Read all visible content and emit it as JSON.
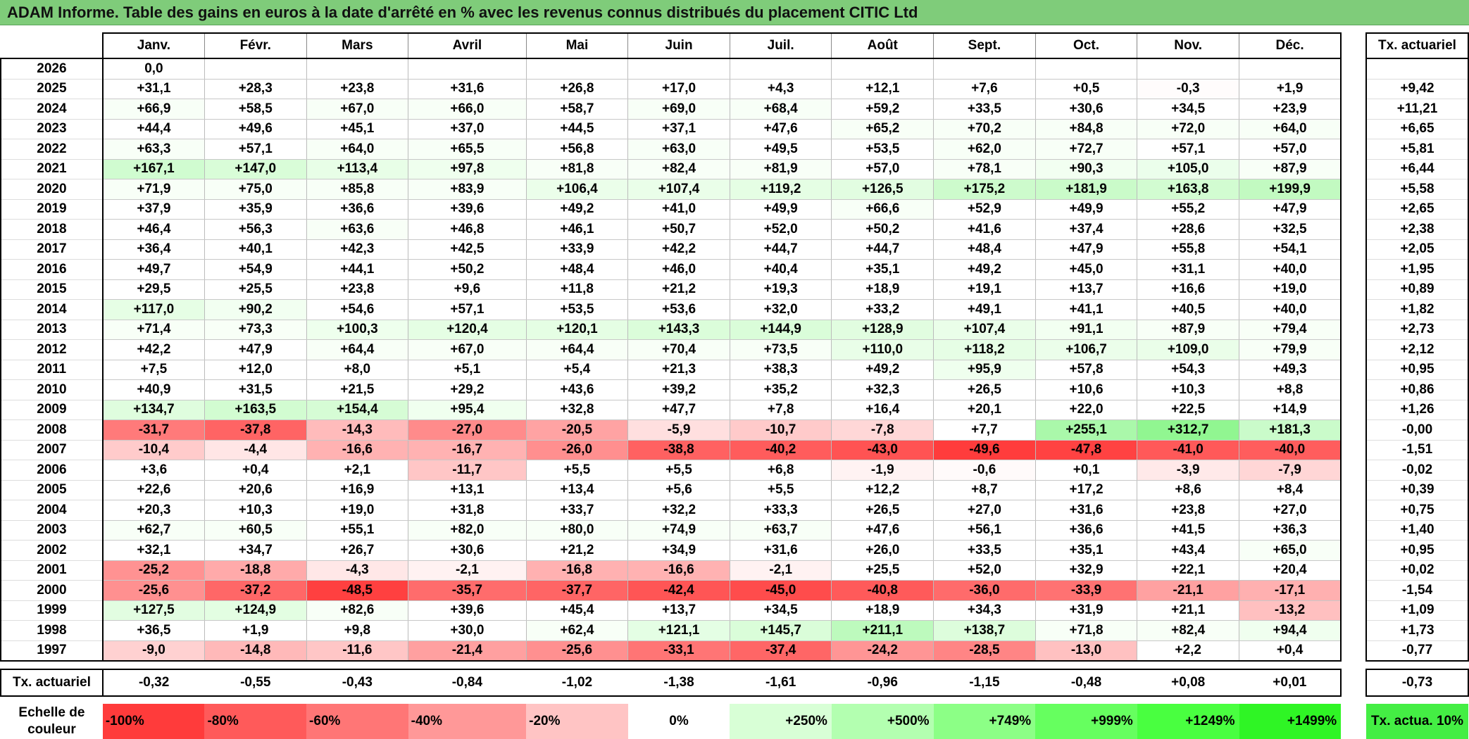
{
  "title": "ADAM Informe. Table des gains en euros à la date d'arrêté en % avec les revenus connus distribués du placement CITIC Ltd",
  "months": [
    "Janv.",
    "Févr.",
    "Mars",
    "Avril",
    "Mai",
    "Juin",
    "Juil.",
    "Août",
    "Sept.",
    "Oct.",
    "Nov.",
    "Déc."
  ],
  "rate_header": "Tx. actuariel",
  "rows": [
    {
      "year": "2026",
      "values": [
        "0,0",
        "",
        "",
        "",
        "",
        "",
        "",
        "",
        "",
        "",
        "",
        ""
      ],
      "rate": ""
    },
    {
      "year": "2025",
      "values": [
        "+31,1",
        "+28,3",
        "+23,8",
        "+31,6",
        "+26,8",
        "+17,0",
        "+4,3",
        "+12,1",
        "+7,6",
        "+0,5",
        "-0,3",
        "+1,9"
      ],
      "rate": "+9,42"
    },
    {
      "year": "2024",
      "values": [
        "+66,9",
        "+58,5",
        "+67,0",
        "+66,0",
        "+58,7",
        "+69,0",
        "+68,4",
        "+59,2",
        "+33,5",
        "+30,6",
        "+34,5",
        "+23,9"
      ],
      "rate": "+11,21"
    },
    {
      "year": "2023",
      "values": [
        "+44,4",
        "+49,6",
        "+45,1",
        "+37,0",
        "+44,5",
        "+37,1",
        "+47,6",
        "+65,2",
        "+70,2",
        "+84,8",
        "+72,0",
        "+64,0"
      ],
      "rate": "+6,65"
    },
    {
      "year": "2022",
      "values": [
        "+63,3",
        "+57,1",
        "+64,0",
        "+65,5",
        "+56,8",
        "+63,0",
        "+49,5",
        "+53,5",
        "+62,0",
        "+72,7",
        "+57,1",
        "+57,0"
      ],
      "rate": "+5,81"
    },
    {
      "year": "2021",
      "values": [
        "+167,1",
        "+147,0",
        "+113,4",
        "+97,8",
        "+81,8",
        "+82,4",
        "+81,9",
        "+57,0",
        "+78,1",
        "+90,3",
        "+105,0",
        "+87,9"
      ],
      "rate": "+6,44"
    },
    {
      "year": "2020",
      "values": [
        "+71,9",
        "+75,0",
        "+85,8",
        "+83,9",
        "+106,4",
        "+107,4",
        "+119,2",
        "+126,5",
        "+175,2",
        "+181,9",
        "+163,8",
        "+199,9"
      ],
      "rate": "+5,58"
    },
    {
      "year": "2019",
      "values": [
        "+37,9",
        "+35,9",
        "+36,6",
        "+39,6",
        "+49,2",
        "+41,0",
        "+49,9",
        "+66,6",
        "+52,9",
        "+49,9",
        "+55,2",
        "+47,9"
      ],
      "rate": "+2,65"
    },
    {
      "year": "2018",
      "values": [
        "+46,4",
        "+56,3",
        "+63,6",
        "+46,8",
        "+46,1",
        "+50,7",
        "+52,0",
        "+50,2",
        "+41,6",
        "+37,4",
        "+28,6",
        "+32,5"
      ],
      "rate": "+2,38"
    },
    {
      "year": "2017",
      "values": [
        "+36,4",
        "+40,1",
        "+42,3",
        "+42,5",
        "+33,9",
        "+42,2",
        "+44,7",
        "+44,7",
        "+48,4",
        "+47,9",
        "+55,8",
        "+54,1"
      ],
      "rate": "+2,05"
    },
    {
      "year": "2016",
      "values": [
        "+49,7",
        "+54,9",
        "+44,1",
        "+50,2",
        "+48,4",
        "+46,0",
        "+40,4",
        "+35,1",
        "+49,2",
        "+45,0",
        "+31,1",
        "+40,0"
      ],
      "rate": "+1,95"
    },
    {
      "year": "2015",
      "values": [
        "+29,5",
        "+25,5",
        "+23,8",
        "+9,6",
        "+11,8",
        "+21,2",
        "+19,3",
        "+18,9",
        "+19,1",
        "+13,7",
        "+16,6",
        "+19,0"
      ],
      "rate": "+0,89"
    },
    {
      "year": "2014",
      "values": [
        "+117,0",
        "+90,2",
        "+54,6",
        "+57,1",
        "+53,5",
        "+53,6",
        "+32,0",
        "+33,2",
        "+49,1",
        "+41,1",
        "+40,5",
        "+40,0"
      ],
      "rate": "+1,82"
    },
    {
      "year": "2013",
      "values": [
        "+71,4",
        "+73,3",
        "+100,3",
        "+120,4",
        "+120,1",
        "+143,3",
        "+144,9",
        "+128,9",
        "+107,4",
        "+91,1",
        "+87,9",
        "+79,4"
      ],
      "rate": "+2,73"
    },
    {
      "year": "2012",
      "values": [
        "+42,2",
        "+47,9",
        "+64,4",
        "+67,0",
        "+64,4",
        "+70,4",
        "+73,5",
        "+110,0",
        "+118,2",
        "+106,7",
        "+109,0",
        "+79,9"
      ],
      "rate": "+2,12"
    },
    {
      "year": "2011",
      "values": [
        "+7,5",
        "+12,0",
        "+8,0",
        "+5,1",
        "+5,4",
        "+21,3",
        "+38,3",
        "+49,2",
        "+95,9",
        "+57,8",
        "+54,3",
        "+49,3"
      ],
      "rate": "+0,95"
    },
    {
      "year": "2010",
      "values": [
        "+40,9",
        "+31,5",
        "+21,5",
        "+29,2",
        "+43,6",
        "+39,2",
        "+35,2",
        "+32,3",
        "+26,5",
        "+10,6",
        "+10,3",
        "+8,8"
      ],
      "rate": "+0,86"
    },
    {
      "year": "2009",
      "values": [
        "+134,7",
        "+163,5",
        "+154,4",
        "+95,4",
        "+32,8",
        "+47,7",
        "+7,8",
        "+16,4",
        "+20,1",
        "+22,0",
        "+22,5",
        "+14,9"
      ],
      "rate": "+1,26"
    },
    {
      "year": "2008",
      "values": [
        "-31,7",
        "-37,8",
        "-14,3",
        "-27,0",
        "-20,5",
        "-5,9",
        "-10,7",
        "-7,8",
        "+7,7",
        "+255,1",
        "+312,7",
        "+181,3"
      ],
      "rate": "-0,00"
    },
    {
      "year": "2007",
      "values": [
        "-10,4",
        "-4,4",
        "-16,6",
        "-16,7",
        "-26,0",
        "-38,8",
        "-40,2",
        "-43,0",
        "-49,6",
        "-47,8",
        "-41,0",
        "-40,0"
      ],
      "rate": "-1,51"
    },
    {
      "year": "2006",
      "values": [
        "+3,6",
        "+0,4",
        "+2,1",
        "-11,7",
        "+5,5",
        "+5,5",
        "+6,8",
        "-1,9",
        "-0,6",
        "+0,1",
        "-3,9",
        "-7,9"
      ],
      "rate": "-0,02"
    },
    {
      "year": "2005",
      "values": [
        "+22,6",
        "+20,6",
        "+16,9",
        "+13,1",
        "+13,4",
        "+5,6",
        "+5,5",
        "+12,2",
        "+8,7",
        "+17,2",
        "+8,6",
        "+8,4"
      ],
      "rate": "+0,39"
    },
    {
      "year": "2004",
      "values": [
        "+20,3",
        "+10,3",
        "+19,0",
        "+31,8",
        "+33,7",
        "+32,2",
        "+33,3",
        "+26,5",
        "+27,0",
        "+31,6",
        "+23,8",
        "+27,0"
      ],
      "rate": "+0,75"
    },
    {
      "year": "2003",
      "values": [
        "+62,7",
        "+60,5",
        "+55,1",
        "+82,0",
        "+80,0",
        "+74,9",
        "+63,7",
        "+47,6",
        "+56,1",
        "+36,6",
        "+41,5",
        "+36,3"
      ],
      "rate": "+1,40"
    },
    {
      "year": "2002",
      "values": [
        "+32,1",
        "+34,7",
        "+26,7",
        "+30,6",
        "+21,2",
        "+34,9",
        "+31,6",
        "+26,0",
        "+33,5",
        "+35,1",
        "+43,4",
        "+65,0"
      ],
      "rate": "+0,95"
    },
    {
      "year": "2001",
      "values": [
        "-25,2",
        "-18,8",
        "-4,3",
        "-2,1",
        "-16,8",
        "-16,6",
        "-2,1",
        "+25,5",
        "+52,0",
        "+32,9",
        "+22,1",
        "+20,4"
      ],
      "rate": "+0,02"
    },
    {
      "year": "2000",
      "values": [
        "-25,6",
        "-37,2",
        "-48,5",
        "-35,7",
        "-37,7",
        "-42,4",
        "-45,0",
        "-40,8",
        "-36,0",
        "-33,9",
        "-21,1",
        "-17,1"
      ],
      "rate": "-1,54"
    },
    {
      "year": "1999",
      "values": [
        "+127,5",
        "+124,9",
        "+82,6",
        "+39,6",
        "+45,4",
        "+13,7",
        "+34,5",
        "+18,9",
        "+34,3",
        "+31,9",
        "+21,1",
        "-13,2"
      ],
      "rate": "+1,09"
    },
    {
      "year": "1998",
      "values": [
        "+36,5",
        "+1,9",
        "+9,8",
        "+30,0",
        "+62,4",
        "+121,1",
        "+145,7",
        "+211,1",
        "+138,7",
        "+71,8",
        "+82,4",
        "+94,4"
      ],
      "rate": "+1,73"
    },
    {
      "year": "1997",
      "values": [
        "-9,0",
        "-14,8",
        "-11,6",
        "-21,4",
        "-25,6",
        "-33,1",
        "-37,4",
        "-24,2",
        "-28,5",
        "-13,0",
        "+2,2",
        "+0,4"
      ],
      "rate": "-0,77"
    }
  ],
  "footer": {
    "label": "Tx. actuariel",
    "values": [
      "-0,32",
      "-0,55",
      "-0,43",
      "-0,84",
      "-1,02",
      "-1,38",
      "-1,61",
      "-0,96",
      "-1,15",
      "-0,48",
      "+0,08",
      "+0,01"
    ],
    "rate": "-0,73"
  },
  "legend": {
    "label": "Echelle de couleur",
    "items": [
      {
        "text": "-100%",
        "color": "#ff3b3b",
        "align": "left"
      },
      {
        "text": "-80%",
        "color": "#ff5a5a",
        "align": "left"
      },
      {
        "text": "-60%",
        "color": "#ff7676",
        "align": "left"
      },
      {
        "text": "-40%",
        "color": "#ff9898",
        "align": "left"
      },
      {
        "text": "-20%",
        "color": "#ffc4c4",
        "align": "left"
      },
      {
        "text": "0%",
        "color": "#ffffff",
        "align": "center"
      },
      {
        "text": "+250%",
        "color": "#d8ffd6",
        "align": "right"
      },
      {
        "text": "+500%",
        "color": "#b3ffb0",
        "align": "right"
      },
      {
        "text": "+749%",
        "color": "#8cff86",
        "align": "right"
      },
      {
        "text": "+999%",
        "color": "#66ff5f",
        "align": "right"
      },
      {
        "text": "+1249%",
        "color": "#49ff40",
        "align": "right"
      },
      {
        "text": "+1499%",
        "color": "#2ff525",
        "align": "right"
      }
    ],
    "rate_label": "Tx. actua. 10%",
    "rate_color": "#44ee44"
  }
}
